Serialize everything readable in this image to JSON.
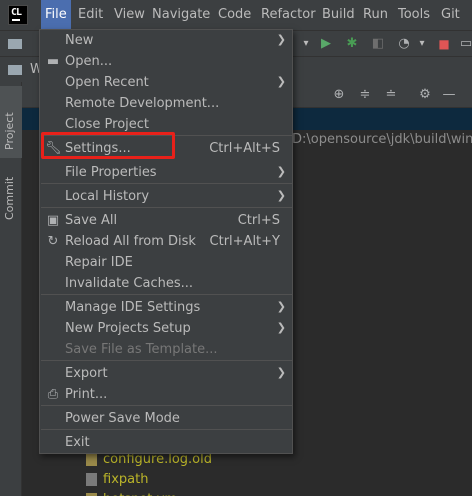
{
  "app": {
    "logo_text": "CL"
  },
  "menubar": {
    "items": [
      "File",
      "Edit",
      "View",
      "Navigate",
      "Code",
      "Refactor",
      "Build",
      "Run",
      "Tools",
      "Git"
    ],
    "active": "File"
  },
  "nav": {
    "folder_text": "W"
  },
  "left_strip": {
    "project_tab": "Project",
    "commit_tab": "Commit"
  },
  "project_panel": {
    "path_text": "D:\\opensource\\jdk\\build\\wind",
    "files": [
      "configure.log.old",
      "fixpath",
      "hotspot-vm"
    ]
  },
  "file_menu": {
    "items": [
      {
        "label": "New",
        "submenu": true
      },
      {
        "label": "Open...",
        "icon": "folder-icon"
      },
      {
        "label": "Open Recent",
        "submenu": true
      },
      {
        "label": "Remote Development..."
      },
      {
        "label": "Close Project"
      },
      {
        "label": "Settings...",
        "icon": "wrench-icon",
        "shortcut": "Ctrl+Alt+S"
      },
      {
        "label": "File Properties",
        "submenu": true
      },
      {
        "label": "Local History",
        "submenu": true
      },
      {
        "label": "Save All",
        "icon": "save-icon",
        "shortcut": "Ctrl+S"
      },
      {
        "label": "Reload All from Disk",
        "icon": "reload-icon",
        "shortcut": "Ctrl+Alt+Y"
      },
      {
        "label": "Repair IDE"
      },
      {
        "label": "Invalidate Caches..."
      },
      {
        "label": "Manage IDE Settings",
        "submenu": true
      },
      {
        "label": "New Projects Setup",
        "submenu": true
      },
      {
        "label": "Save File as Template...",
        "disabled": true
      },
      {
        "label": "Export",
        "submenu": true
      },
      {
        "label": "Print...",
        "icon": "print-icon"
      },
      {
        "label": "Power Save Mode"
      },
      {
        "label": "Exit"
      }
    ]
  },
  "colors": {
    "highlight_box": "#e8211a",
    "menu_active": "#4b6eaf",
    "run_icon": "#59a869",
    "debug_icon": "#499c54"
  }
}
